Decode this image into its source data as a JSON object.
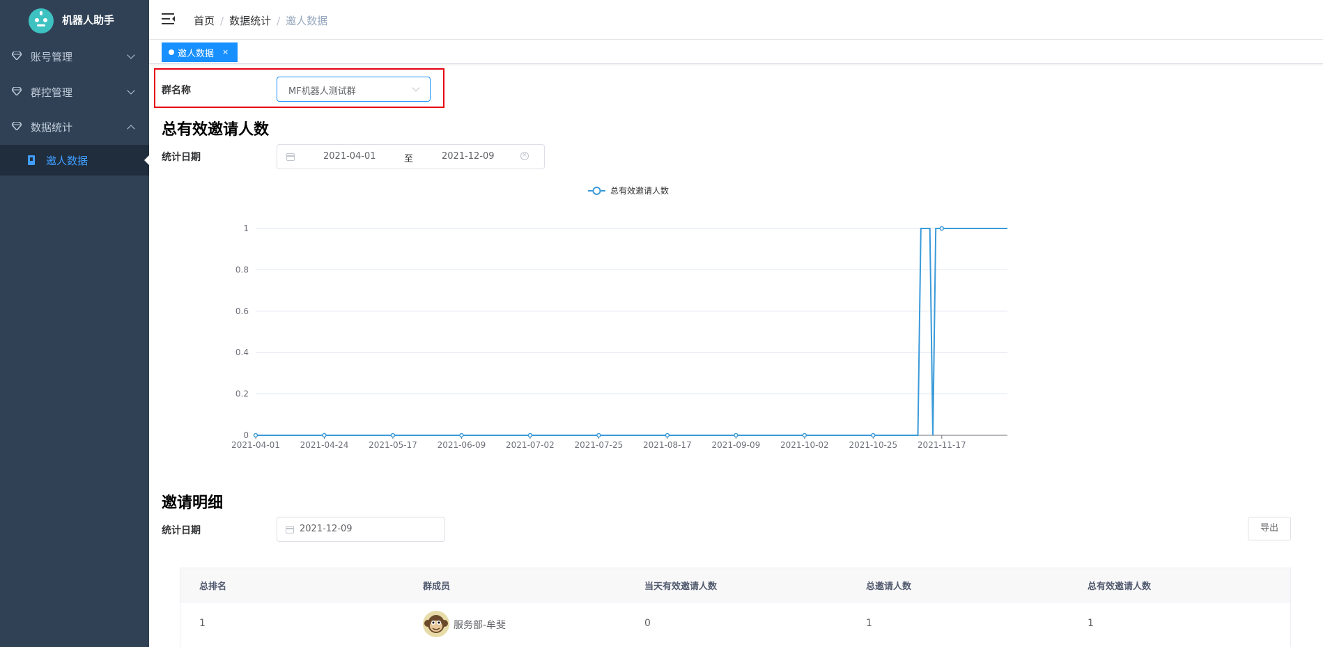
{
  "app": {
    "title": "机器人助手"
  },
  "sidebar": {
    "items": [
      {
        "label": "账号管理",
        "expanded": false
      },
      {
        "label": "群控管理",
        "expanded": false
      },
      {
        "label": "数据统计",
        "expanded": true
      }
    ],
    "sub_item": {
      "label": "邀人数据"
    }
  },
  "breadcrumb": [
    "首页",
    "数据统计",
    "邀人数据"
  ],
  "tags_view": {
    "active_tag": "邀人数据",
    "close": "×"
  },
  "filter": {
    "group_label": "群名称",
    "group_value": "MF机器人测试群"
  },
  "section1": {
    "title": "总有效邀请人数",
    "date_label": "统计日期",
    "range_start": "2021-04-01",
    "range_sep": "至",
    "range_end": "2021-12-09"
  },
  "chart_data": {
    "type": "line",
    "legend": "总有效邀请人数",
    "legend_position": "top-center",
    "series": [
      {
        "name": "总有效邀请人数",
        "color": "#3a9ad9",
        "points": [
          [
            "2021-04-01",
            0
          ],
          [
            "2021-11-09",
            0
          ],
          [
            "2021-11-10",
            1
          ],
          [
            "2021-11-13",
            1
          ],
          [
            "2021-11-14",
            0
          ],
          [
            "2021-11-15",
            1
          ],
          [
            "2021-12-09",
            1
          ]
        ]
      }
    ],
    "x_ticks": [
      "2021-04-01",
      "2021-04-24",
      "2021-05-17",
      "2021-06-09",
      "2021-07-02",
      "2021-07-25",
      "2021-08-17",
      "2021-09-09",
      "2021-10-02",
      "2021-10-25",
      "2021-11-17"
    ],
    "y_ticks": [
      "0",
      "0.2",
      "0.4",
      "0.6",
      "0.8",
      "1"
    ],
    "ylim": [
      0,
      1
    ],
    "xlim": [
      "2021-04-01",
      "2021-12-09"
    ],
    "grid": true
  },
  "section2": {
    "title": "邀请明细",
    "date_label": "统计日期",
    "date_value": "2021-12-09",
    "export_label": "导出"
  },
  "table": {
    "columns": [
      "总排名",
      "群成员",
      "当天有效邀请人数",
      "总邀请人数",
      "总有效邀请人数"
    ],
    "rows": [
      {
        "rank": "1",
        "member": "服务部-牟斐",
        "today_valid": "0",
        "total": "1",
        "total_valid": "1"
      }
    ]
  }
}
